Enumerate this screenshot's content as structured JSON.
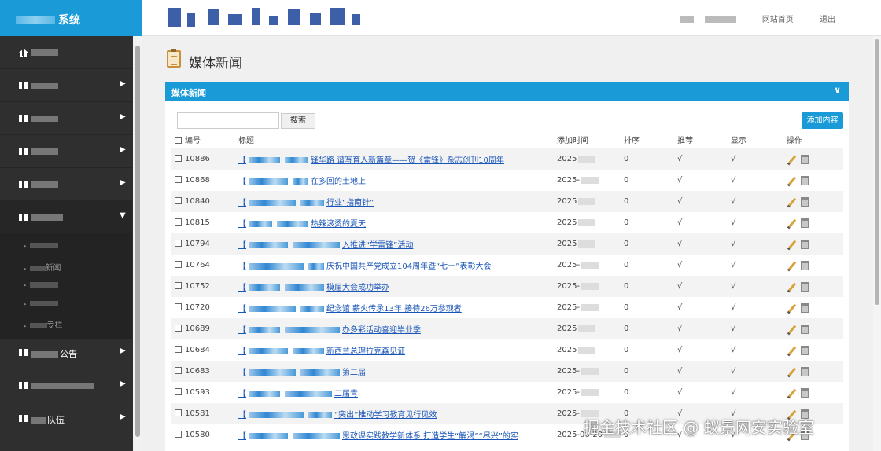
{
  "brand": {
    "title_suffix": "系统"
  },
  "topbar": {
    "links": [
      "网站首页",
      "退出"
    ]
  },
  "sidebar": {
    "items": [
      {
        "label_suffix": "",
        "icon": "home-icon",
        "has_arrow": false
      },
      {
        "label_suffix": "",
        "icon": "grid-icon",
        "has_arrow": true
      },
      {
        "label_suffix": "",
        "icon": "grid-icon",
        "has_arrow": true
      },
      {
        "label_suffix": "",
        "icon": "grid-icon",
        "has_arrow": true
      },
      {
        "label_suffix": "",
        "icon": "grid-icon",
        "has_arrow": true
      },
      {
        "label_suffix": "",
        "icon": "grid-icon",
        "has_arrow": true,
        "open": true
      },
      {
        "label_suffix": "公告",
        "icon": "grid-icon",
        "has_arrow": true
      },
      {
        "label_suffix": "",
        "icon": "grid-icon",
        "has_arrow": true
      },
      {
        "label_suffix": "队伍",
        "icon": "grid-icon",
        "has_arrow": true
      }
    ],
    "sub_items": [
      "",
      "新闻",
      "",
      "",
      "专栏"
    ],
    "arrow_right": "▶",
    "arrow_down": "▼"
  },
  "page": {
    "title": "媒体新闻"
  },
  "panel": {
    "title": "媒体新闻",
    "collapse_glyph": "∨"
  },
  "toolbar": {
    "search_label": "搜索",
    "search_placeholder": "",
    "add_label": "添加内容"
  },
  "table": {
    "headers": {
      "id": "编号",
      "title": "标题",
      "time": "添加时间",
      "sort": "排序",
      "recommend": "推荐",
      "show": "显示",
      "ops": "操作"
    },
    "rows": [
      {
        "id": "10886",
        "title_a": "【",
        "title_b": "锋华路 谱写育人新篇章——贺《雷锋》杂志创刊10周年",
        "time": "2025",
        "sort": "0",
        "recommend": "√",
        "show": "√"
      },
      {
        "id": "10868",
        "title_a": "【",
        "title_b": "在多回的土地上",
        "time": "2025-",
        "sort": "0",
        "recommend": "√",
        "show": "√"
      },
      {
        "id": "10840",
        "title_a": "【",
        "title_b": "行业“指南针”",
        "time": "2025",
        "sort": "0",
        "recommend": "√",
        "show": "√"
      },
      {
        "id": "10815",
        "title_a": "【",
        "title_b": "热辣滚烫的夏天",
        "time": "2025",
        "sort": "0",
        "recommend": "√",
        "show": "√"
      },
      {
        "id": "10794",
        "title_a": "【",
        "title_b": "入推进“学雷锋”活动",
        "time": "2025",
        "sort": "0",
        "recommend": "√",
        "show": "√"
      },
      {
        "id": "10764",
        "title_a": "【",
        "title_b": "庆祝中国共产党成立104周年暨“七一”表彰大会",
        "time": "2025-",
        "sort": "0",
        "recommend": "√",
        "show": "√"
      },
      {
        "id": "10752",
        "title_a": "【",
        "title_b": "模届大会成功举办",
        "time": "2025-",
        "sort": "0",
        "recommend": "√",
        "show": "√"
      },
      {
        "id": "10720",
        "title_a": "【",
        "title_b": "纪念馆 薪火传承13年 接待26万参观者",
        "time": "2025-",
        "sort": "0",
        "recommend": "√",
        "show": "√"
      },
      {
        "id": "10689",
        "title_a": "【",
        "title_b": "办多彩活动喜迎毕业季",
        "time": "2025",
        "sort": "0",
        "recommend": "√",
        "show": "√"
      },
      {
        "id": "10684",
        "title_a": "【",
        "title_b": "新西兰总理拉克森见证",
        "time": "2025",
        "sort": "0",
        "recommend": "√",
        "show": "√"
      },
      {
        "id": "10683",
        "title_a": "【",
        "title_b": "第二届",
        "time": "2025-",
        "sort": "0",
        "recommend": "√",
        "show": "√"
      },
      {
        "id": "10593",
        "title_a": "【",
        "title_b": "二届青",
        "time": "2025-",
        "sort": "0",
        "recommend": "√",
        "show": "√"
      },
      {
        "id": "10581",
        "title_a": "【",
        "title_b": "“突出”推动学习教育见行见效",
        "time": "2025-",
        "sort": "0",
        "recommend": "√",
        "show": "√"
      },
      {
        "id": "10580",
        "title_a": "【",
        "title_b": "思政课实践教学新体系 打造学生“解渴”“尽兴”的实",
        "time": "2025-06-20",
        "sort": "0",
        "recommend": "√",
        "show": "√"
      }
    ]
  },
  "watermark": "掘金技术社区 @ 蚁景网安实验室"
}
